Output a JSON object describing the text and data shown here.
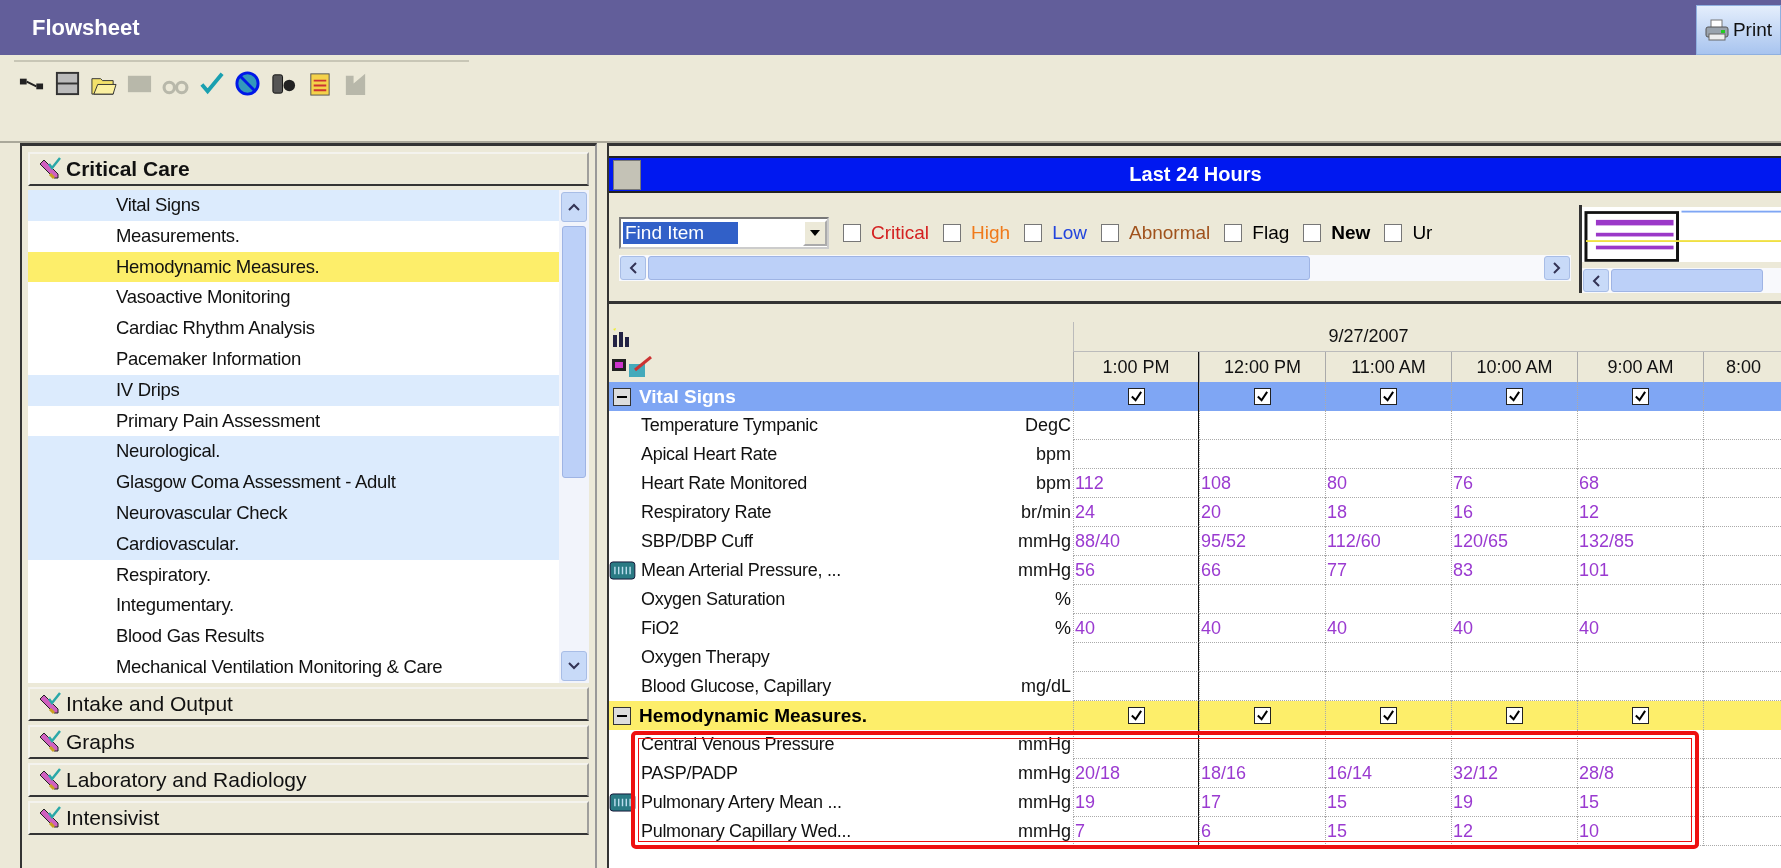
{
  "window": {
    "title": "Flowsheet",
    "print_button": "Print"
  },
  "sidebar": {
    "sections": [
      {
        "label": "Critical Care",
        "expanded": true,
        "items": [
          {
            "label": "Vital Signs",
            "selected": false,
            "charted": true
          },
          {
            "label": "Measurements.",
            "selected": false,
            "charted": false
          },
          {
            "label": "Hemodynamic Measures.",
            "selected": true,
            "charted": false
          },
          {
            "label": "Vasoactive Monitoring",
            "selected": false,
            "charted": false
          },
          {
            "label": "Cardiac Rhythm Analysis",
            "selected": false,
            "charted": false
          },
          {
            "label": "Pacemaker Information",
            "selected": false,
            "charted": false
          },
          {
            "label": "IV Drips",
            "selected": false,
            "charted": true
          },
          {
            "label": "Primary Pain Assessment",
            "selected": false,
            "charted": false
          },
          {
            "label": "Neurological.",
            "selected": false,
            "charted": true
          },
          {
            "label": "Glasgow Coma Assessment - Adult",
            "selected": false,
            "charted": true
          },
          {
            "label": "Neurovascular Check",
            "selected": false,
            "charted": true
          },
          {
            "label": "Cardiovascular.",
            "selected": false,
            "charted": true
          },
          {
            "label": "Respiratory.",
            "selected": false,
            "charted": false
          },
          {
            "label": "Integumentary.",
            "selected": false,
            "charted": false
          },
          {
            "label": "Blood Gas Results",
            "selected": false,
            "charted": false
          },
          {
            "label": "Mechanical Ventilation Monitoring & Care",
            "selected": false,
            "charted": false
          }
        ]
      },
      {
        "label": "Intake and Output",
        "expanded": false
      },
      {
        "label": "Graphs",
        "expanded": false
      },
      {
        "label": "Laboratory and Radiology",
        "expanded": false
      },
      {
        "label": "Intensivist",
        "expanded": false
      }
    ]
  },
  "banner": "Last 24 Hours",
  "filters": {
    "find_field": {
      "value": "Find Item"
    },
    "checkboxes": [
      {
        "label": "Critical",
        "checked": false,
        "color": "#d42020",
        "bold": false
      },
      {
        "label": "High",
        "checked": false,
        "color": "#f07a1a",
        "bold": false
      },
      {
        "label": "Low",
        "checked": false,
        "color": "#2244dd",
        "bold": false
      },
      {
        "label": "Abnormal",
        "checked": false,
        "color": "#a0521c",
        "bold": false
      },
      {
        "label": "Flag",
        "checked": false,
        "color": "#000000",
        "bold": false
      },
      {
        "label": "New",
        "checked": false,
        "color": "#000000",
        "bold": true
      },
      {
        "label": "Ur",
        "checked": false,
        "color": "#000000",
        "bold": false
      }
    ]
  },
  "grid": {
    "date": "9/27/2007",
    "columns": [
      "1:00 PM",
      "12:00 PM",
      "11:00 AM",
      "10:00 AM",
      "9:00 AM",
      "8:00"
    ],
    "groups": [
      {
        "label": "Vital Signs",
        "selected": false,
        "expanded": true,
        "annotated": false,
        "checks": [
          true,
          true,
          true,
          true,
          true
        ],
        "rows": [
          {
            "label": "Temperature Tympanic",
            "unit": "DegC",
            "device": false
          },
          {
            "label": "Apical Heart Rate",
            "unit": "bpm",
            "device": false
          },
          {
            "label": "Heart Rate Monitored",
            "unit": "bpm",
            "device": false,
            "values": [
              "112",
              "108",
              "80",
              "76",
              "68"
            ]
          },
          {
            "label": "Respiratory Rate",
            "unit": "br/min",
            "device": false,
            "values": [
              "24",
              "20",
              "18",
              "16",
              "12"
            ]
          },
          {
            "label": "SBP/DBP Cuff",
            "unit": "mmHg",
            "device": false,
            "values": [
              "88/40",
              "95/52",
              "112/60",
              "120/65",
              "132/85"
            ]
          },
          {
            "label": "Mean Arterial Pressure, ...",
            "unit": "mmHg",
            "device": true,
            "values": [
              "56",
              "66",
              "77",
              "83",
              "101"
            ]
          },
          {
            "label": "Oxygen Saturation",
            "unit": "%",
            "device": false
          },
          {
            "label": "FiO2",
            "unit": "%",
            "device": false,
            "values": [
              "40",
              "40",
              "40",
              "40",
              "40"
            ]
          },
          {
            "label": "Oxygen Therapy",
            "device": false
          },
          {
            "label": "Blood Glucose, Capillary",
            "unit": "mg/dL",
            "device": false
          }
        ]
      },
      {
        "label": "Hemodynamic Measures.",
        "selected": true,
        "expanded": true,
        "annotated": true,
        "checks": [
          true,
          true,
          true,
          true,
          true
        ],
        "rows": [
          {
            "label": "Central Venous Pressure",
            "unit": "mmHg",
            "device": false
          },
          {
            "label": "PASP/PADP",
            "unit": "mmHg",
            "device": false,
            "values": [
              "20/18",
              "18/16",
              "16/14",
              "32/12",
              "28/8"
            ]
          },
          {
            "label": "Pulmonary Artery Mean ...",
            "unit": "mmHg",
            "device": true,
            "values": [
              "19",
              "17",
              "15",
              "19",
              "15"
            ]
          },
          {
            "label": "Pulmonary Capillary Wed...",
            "unit": "mmHg",
            "device": false,
            "values": [
              "7",
              "6",
              "15",
              "12",
              "10"
            ]
          }
        ]
      }
    ]
  }
}
